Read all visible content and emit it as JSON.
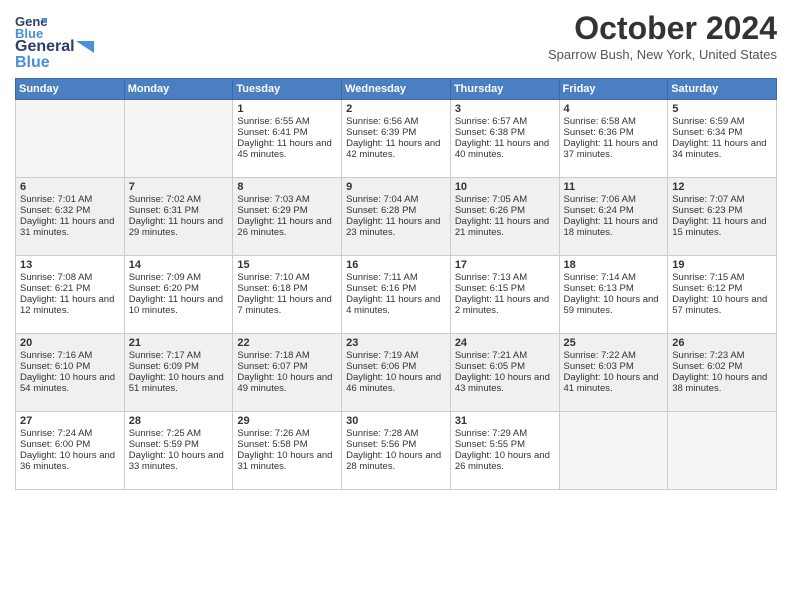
{
  "header": {
    "logo_line1": "General",
    "logo_line2": "Blue",
    "month": "October 2024",
    "location": "Sparrow Bush, New York, United States"
  },
  "weekdays": [
    "Sunday",
    "Monday",
    "Tuesday",
    "Wednesday",
    "Thursday",
    "Friday",
    "Saturday"
  ],
  "days": [
    {
      "num": "",
      "sunrise": "",
      "sunset": "",
      "daylight": "",
      "empty": true
    },
    {
      "num": "",
      "sunrise": "",
      "sunset": "",
      "daylight": "",
      "empty": true
    },
    {
      "num": "1",
      "sunrise": "Sunrise: 6:55 AM",
      "sunset": "Sunset: 6:41 PM",
      "daylight": "Daylight: 11 hours and 45 minutes."
    },
    {
      "num": "2",
      "sunrise": "Sunrise: 6:56 AM",
      "sunset": "Sunset: 6:39 PM",
      "daylight": "Daylight: 11 hours and 42 minutes."
    },
    {
      "num": "3",
      "sunrise": "Sunrise: 6:57 AM",
      "sunset": "Sunset: 6:38 PM",
      "daylight": "Daylight: 11 hours and 40 minutes."
    },
    {
      "num": "4",
      "sunrise": "Sunrise: 6:58 AM",
      "sunset": "Sunset: 6:36 PM",
      "daylight": "Daylight: 11 hours and 37 minutes."
    },
    {
      "num": "5",
      "sunrise": "Sunrise: 6:59 AM",
      "sunset": "Sunset: 6:34 PM",
      "daylight": "Daylight: 11 hours and 34 minutes."
    },
    {
      "num": "6",
      "sunrise": "Sunrise: 7:01 AM",
      "sunset": "Sunset: 6:32 PM",
      "daylight": "Daylight: 11 hours and 31 minutes."
    },
    {
      "num": "7",
      "sunrise": "Sunrise: 7:02 AM",
      "sunset": "Sunset: 6:31 PM",
      "daylight": "Daylight: 11 hours and 29 minutes."
    },
    {
      "num": "8",
      "sunrise": "Sunrise: 7:03 AM",
      "sunset": "Sunset: 6:29 PM",
      "daylight": "Daylight: 11 hours and 26 minutes."
    },
    {
      "num": "9",
      "sunrise": "Sunrise: 7:04 AM",
      "sunset": "Sunset: 6:28 PM",
      "daylight": "Daylight: 11 hours and 23 minutes."
    },
    {
      "num": "10",
      "sunrise": "Sunrise: 7:05 AM",
      "sunset": "Sunset: 6:26 PM",
      "daylight": "Daylight: 11 hours and 21 minutes."
    },
    {
      "num": "11",
      "sunrise": "Sunrise: 7:06 AM",
      "sunset": "Sunset: 6:24 PM",
      "daylight": "Daylight: 11 hours and 18 minutes."
    },
    {
      "num": "12",
      "sunrise": "Sunrise: 7:07 AM",
      "sunset": "Sunset: 6:23 PM",
      "daylight": "Daylight: 11 hours and 15 minutes."
    },
    {
      "num": "13",
      "sunrise": "Sunrise: 7:08 AM",
      "sunset": "Sunset: 6:21 PM",
      "daylight": "Daylight: 11 hours and 12 minutes."
    },
    {
      "num": "14",
      "sunrise": "Sunrise: 7:09 AM",
      "sunset": "Sunset: 6:20 PM",
      "daylight": "Daylight: 11 hours and 10 minutes."
    },
    {
      "num": "15",
      "sunrise": "Sunrise: 7:10 AM",
      "sunset": "Sunset: 6:18 PM",
      "daylight": "Daylight: 11 hours and 7 minutes."
    },
    {
      "num": "16",
      "sunrise": "Sunrise: 7:11 AM",
      "sunset": "Sunset: 6:16 PM",
      "daylight": "Daylight: 11 hours and 4 minutes."
    },
    {
      "num": "17",
      "sunrise": "Sunrise: 7:13 AM",
      "sunset": "Sunset: 6:15 PM",
      "daylight": "Daylight: 11 hours and 2 minutes."
    },
    {
      "num": "18",
      "sunrise": "Sunrise: 7:14 AM",
      "sunset": "Sunset: 6:13 PM",
      "daylight": "Daylight: 10 hours and 59 minutes."
    },
    {
      "num": "19",
      "sunrise": "Sunrise: 7:15 AM",
      "sunset": "Sunset: 6:12 PM",
      "daylight": "Daylight: 10 hours and 57 minutes."
    },
    {
      "num": "20",
      "sunrise": "Sunrise: 7:16 AM",
      "sunset": "Sunset: 6:10 PM",
      "daylight": "Daylight: 10 hours and 54 minutes."
    },
    {
      "num": "21",
      "sunrise": "Sunrise: 7:17 AM",
      "sunset": "Sunset: 6:09 PM",
      "daylight": "Daylight: 10 hours and 51 minutes."
    },
    {
      "num": "22",
      "sunrise": "Sunrise: 7:18 AM",
      "sunset": "Sunset: 6:07 PM",
      "daylight": "Daylight: 10 hours and 49 minutes."
    },
    {
      "num": "23",
      "sunrise": "Sunrise: 7:19 AM",
      "sunset": "Sunset: 6:06 PM",
      "daylight": "Daylight: 10 hours and 46 minutes."
    },
    {
      "num": "24",
      "sunrise": "Sunrise: 7:21 AM",
      "sunset": "Sunset: 6:05 PM",
      "daylight": "Daylight: 10 hours and 43 minutes."
    },
    {
      "num": "25",
      "sunrise": "Sunrise: 7:22 AM",
      "sunset": "Sunset: 6:03 PM",
      "daylight": "Daylight: 10 hours and 41 minutes."
    },
    {
      "num": "26",
      "sunrise": "Sunrise: 7:23 AM",
      "sunset": "Sunset: 6:02 PM",
      "daylight": "Daylight: 10 hours and 38 minutes."
    },
    {
      "num": "27",
      "sunrise": "Sunrise: 7:24 AM",
      "sunset": "Sunset: 6:00 PM",
      "daylight": "Daylight: 10 hours and 36 minutes."
    },
    {
      "num": "28",
      "sunrise": "Sunrise: 7:25 AM",
      "sunset": "Sunset: 5:59 PM",
      "daylight": "Daylight: 10 hours and 33 minutes."
    },
    {
      "num": "29",
      "sunrise": "Sunrise: 7:26 AM",
      "sunset": "Sunset: 5:58 PM",
      "daylight": "Daylight: 10 hours and 31 minutes."
    },
    {
      "num": "30",
      "sunrise": "Sunrise: 7:28 AM",
      "sunset": "Sunset: 5:56 PM",
      "daylight": "Daylight: 10 hours and 28 minutes."
    },
    {
      "num": "31",
      "sunrise": "Sunrise: 7:29 AM",
      "sunset": "Sunset: 5:55 PM",
      "daylight": "Daylight: 10 hours and 26 minutes."
    },
    {
      "num": "",
      "sunrise": "",
      "sunset": "",
      "daylight": "",
      "empty": true
    },
    {
      "num": "",
      "sunrise": "",
      "sunset": "",
      "daylight": "",
      "empty": true
    }
  ]
}
